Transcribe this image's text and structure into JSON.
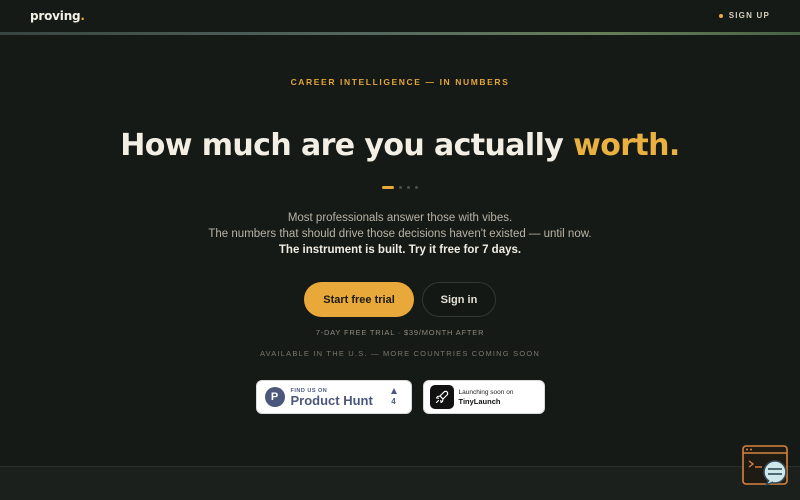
{
  "header": {
    "logo_text": "proving",
    "logo_dot": ".",
    "signup_label": "SIGN UP"
  },
  "hero": {
    "eyebrow": "CAREER INTELLIGENCE — IN NUMBERS",
    "headline_main": "How much are you actually ",
    "headline_accent": "worth.",
    "sub_line1": "Most professionals answer those with vibes.",
    "sub_line2": "The numbers that should drive those decisions haven't existed — until now.",
    "sub_line3": "The instrument is built. Try it free for 7 days.",
    "carousel": {
      "total": 4,
      "active": 1
    }
  },
  "cta": {
    "primary_label": "Start free trial",
    "secondary_label": "Sign in",
    "trial_note": "7-DAY FREE TRIAL · $39/MONTH AFTER",
    "availability_note": "AVAILABLE IN THE U.S. — MORE COUNTRIES COMING SOON"
  },
  "badges": {
    "producthunt": {
      "logo_letter": "P",
      "small": "FIND US ON",
      "big": "Product Hunt",
      "count": "4"
    },
    "tinylaunch": {
      "small": "Launching soon on",
      "big": "TinyLaunch"
    }
  },
  "colors": {
    "accent": "#e8a93a",
    "background": "#161a16",
    "ph_brand": "#4b587c"
  },
  "icons": {
    "chat_widget": "chat-support-icon",
    "rocket": "rocket-icon",
    "upvote": "triangle-up-icon"
  }
}
